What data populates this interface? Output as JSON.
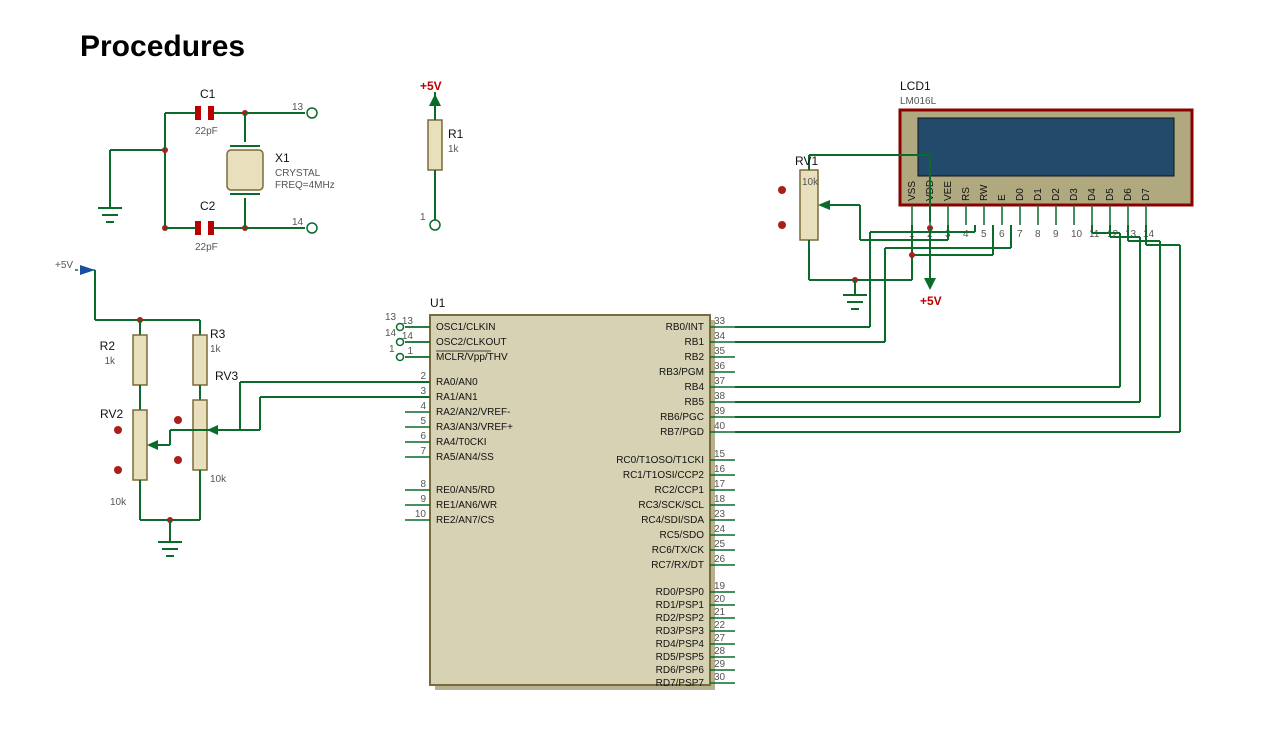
{
  "title": "Procedures",
  "power": {
    "p5v": "+5V"
  },
  "components": {
    "C1": {
      "ref": "C1",
      "val": "22pF"
    },
    "C2": {
      "ref": "C2",
      "val": "22pF"
    },
    "X1": {
      "ref": "X1",
      "type": "CRYSTAL",
      "freq": "FREQ=4MHz"
    },
    "R1": {
      "ref": "R1",
      "val": "1k"
    },
    "R2": {
      "ref": "R2",
      "val": "1k"
    },
    "R3": {
      "ref": "R3",
      "val": "1k"
    },
    "RV1": {
      "ref": "RV1",
      "val": "10k"
    },
    "RV2": {
      "ref": "RV2",
      "val": "10k"
    },
    "RV3": {
      "ref": "RV3",
      "val": "10k"
    },
    "U1": {
      "ref": "U1"
    },
    "LCD1": {
      "ref": "LCD1",
      "part": "LM016L"
    }
  },
  "u1_left_pins": {
    "group1": [
      {
        "num": "13",
        "label": "OSC1/CLKIN"
      },
      {
        "num": "14",
        "label": "OSC2/CLKOUT"
      },
      {
        "num": "1",
        "label": "MCLR/Vpp/THV",
        "bar": true
      }
    ],
    "group2": [
      {
        "num": "2",
        "label": "RA0/AN0"
      },
      {
        "num": "3",
        "label": "RA1/AN1"
      },
      {
        "num": "4",
        "label": "RA2/AN2/VREF-"
      },
      {
        "num": "5",
        "label": "RA3/AN3/VREF+"
      },
      {
        "num": "6",
        "label": "RA4/T0CKI"
      },
      {
        "num": "7",
        "label": "RA5/AN4/SS",
        "bar": true
      }
    ],
    "group3": [
      {
        "num": "8",
        "label": "RE0/AN5/RD",
        "bar": true
      },
      {
        "num": "9",
        "label": "RE1/AN6/WR",
        "bar": true
      },
      {
        "num": "10",
        "label": "RE2/AN7/CS",
        "bar": true
      }
    ]
  },
  "u1_right_pins": {
    "group1": [
      {
        "num": "33",
        "label": "RB0/INT"
      },
      {
        "num": "34",
        "label": "RB1"
      },
      {
        "num": "35",
        "label": "RB2"
      },
      {
        "num": "36",
        "label": "RB3/PGM"
      },
      {
        "num": "37",
        "label": "RB4"
      },
      {
        "num": "38",
        "label": "RB5"
      },
      {
        "num": "39",
        "label": "RB6/PGC"
      },
      {
        "num": "40",
        "label": "RB7/PGD"
      }
    ],
    "group2": [
      {
        "num": "15",
        "label": "RC0/T1OSO/T1CKI"
      },
      {
        "num": "16",
        "label": "RC1/T1OSI/CCP2"
      },
      {
        "num": "17",
        "label": "RC2/CCP1"
      },
      {
        "num": "18",
        "label": "RC3/SCK/SCL"
      },
      {
        "num": "23",
        "label": "RC4/SDI/SDA"
      },
      {
        "num": "24",
        "label": "RC5/SDO"
      },
      {
        "num": "25",
        "label": "RC6/TX/CK"
      },
      {
        "num": "26",
        "label": "RC7/RX/DT"
      }
    ],
    "group3": [
      {
        "num": "19",
        "label": "RD0/PSP0"
      },
      {
        "num": "20",
        "label": "RD1/PSP1"
      },
      {
        "num": "21",
        "label": "RD2/PSP2"
      },
      {
        "num": "22",
        "label": "RD3/PSP3"
      },
      {
        "num": "27",
        "label": "RD4/PSP4"
      },
      {
        "num": "28",
        "label": "RD5/PSP5"
      },
      {
        "num": "29",
        "label": "RD6/PSP6"
      },
      {
        "num": "30",
        "label": "RD7/PSP7"
      }
    ]
  },
  "lcd_pins": [
    "VSS",
    "VDD",
    "VEE",
    "RS",
    "RW",
    "E",
    "D0",
    "D1",
    "D2",
    "D3",
    "D4",
    "D5",
    "D6",
    "D7"
  ],
  "lcd_pin_nums": [
    "1",
    "2",
    "3",
    "4",
    "5",
    "6",
    "7",
    "8",
    "9",
    "10",
    "11",
    "12",
    "13",
    "14"
  ],
  "osc_terms": {
    "t13": "13",
    "t14": "14",
    "t1": "1"
  }
}
